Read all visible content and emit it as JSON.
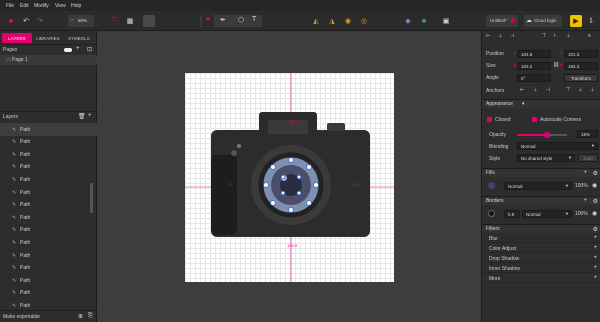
{
  "menu": {
    "items": [
      "File",
      "Edit",
      "Modify",
      "View",
      "Help"
    ]
  },
  "toolbar": {
    "zoom": "50%",
    "document_tab": "Untitled*",
    "cloud_login": "Cloud login"
  },
  "left_panel": {
    "tabs": [
      "LAYERS",
      "LIBRARIES",
      "SYMBOLS"
    ],
    "pages_header": "Pages",
    "pages": [
      {
        "label": "Page 1"
      }
    ],
    "layers_header": "Layers",
    "layers": [
      "Path",
      "Path",
      "Path",
      "Path",
      "Path",
      "Path",
      "Path",
      "Path",
      "Path",
      "Path",
      "Path",
      "Path",
      "Path",
      "Path",
      "Path"
    ],
    "footer": "Make exportable"
  },
  "canvas": {
    "width_label": "350",
    "height_label": "194.9",
    "dim_top": "361.3",
    "dim_left": "78",
    "dim_right": "100"
  },
  "right_panel": {
    "position_label": "Position",
    "pos_x": "X",
    "pos_x_value": "104.6",
    "pos_y": "Y",
    "pos_y_value": "101.3",
    "size_label": "Size",
    "size_w": "W",
    "size_w_value": "193.2",
    "size_h": "H",
    "size_h_value": "194.3",
    "angle_label": "Angle",
    "angle_value": "0°",
    "transform_button": "Transform",
    "anchors_label": "Anchors",
    "appearance_header": "Appearance",
    "closed_label": "Closed",
    "autoscale_label": "Autoscale Corners",
    "opacity_label": "Opacity",
    "opacity_value": "19%",
    "opacity_fraction": 0.6,
    "blending_label": "Blending",
    "blending_value": "Normal",
    "style_label": "Style",
    "style_value": "No shared style",
    "style_button": "Auto",
    "fills_header": "Fills",
    "fill_mode": "Normal",
    "fill_opacity": "100%",
    "borders_header": "Borders",
    "border_width": "0.9",
    "border_mode": "Normal",
    "border_opacity": "100%",
    "filters_header": "Filters",
    "filters": [
      "Blur",
      "Color Adjust",
      "Drop Shadow",
      "Inner Shadow",
      "More"
    ]
  },
  "colors": {
    "accent": "#e5006e",
    "highlight": "#f0c300",
    "guide": "#e5007e"
  }
}
